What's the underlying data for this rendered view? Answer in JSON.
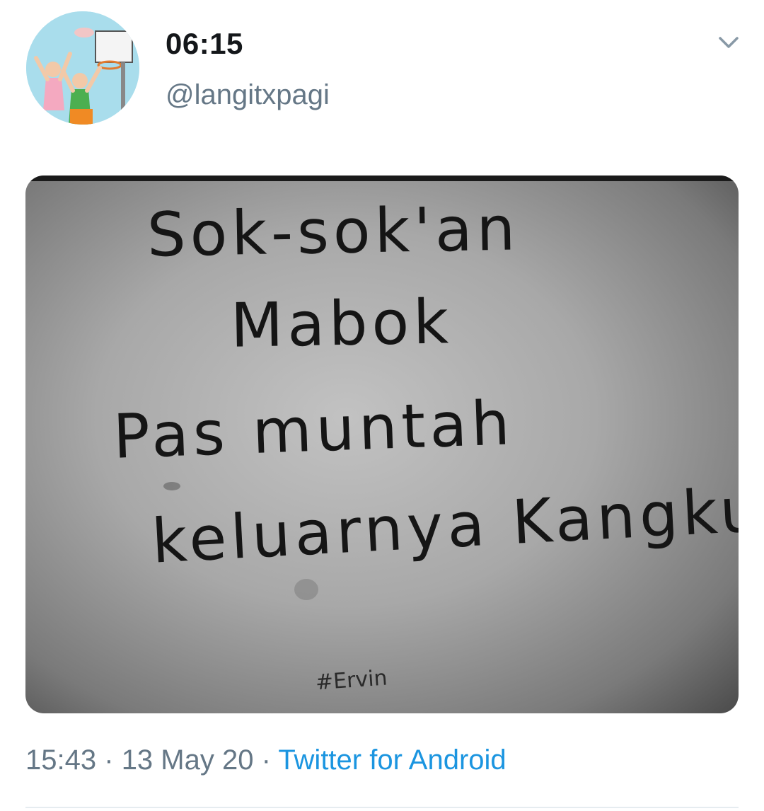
{
  "tweet": {
    "display_name": "06:15",
    "handle": "@langitxpagi",
    "avatar_icon": "avatar-illustration-icon",
    "menu_icon": "chevron-down-icon",
    "media": {
      "lines": [
        "Sok-sok'an",
        "Mabok",
        "Pas muntah",
        "keluarnya Kangkung"
      ],
      "signature": "#Ervin"
    },
    "meta": {
      "time": "15:43",
      "separator": "·",
      "date": "13 May 20",
      "source": "Twitter for Android"
    }
  },
  "colors": {
    "name": "#14171a",
    "secondary": "#657786",
    "link": "#1b95e0",
    "divider": "#e6ecf0"
  }
}
